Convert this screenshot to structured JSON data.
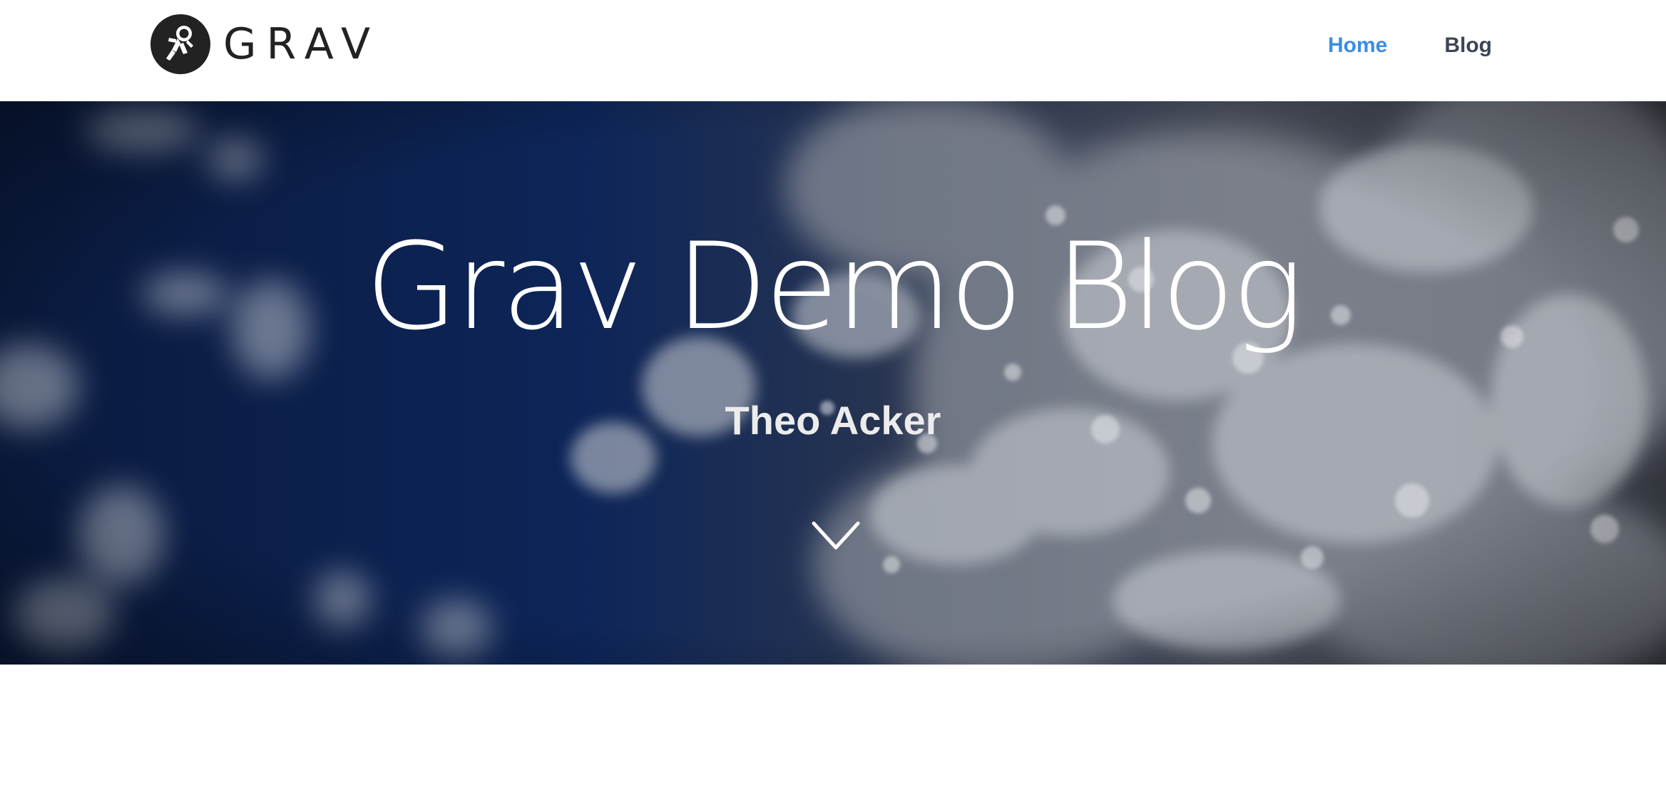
{
  "header": {
    "logo": {
      "text": "GRAV",
      "icon": "astronaut-icon"
    },
    "nav": [
      {
        "label": "Home",
        "active": true
      },
      {
        "label": "Blog",
        "active": false
      }
    ]
  },
  "hero": {
    "title": "Grav Demo Blog",
    "subtitle": "Theo Acker",
    "scroll_icon": "chevron-down-icon"
  },
  "colors": {
    "accent": "#3b8de3",
    "nav_text": "#3c4456",
    "hero_dark": "#0c1a3a"
  }
}
